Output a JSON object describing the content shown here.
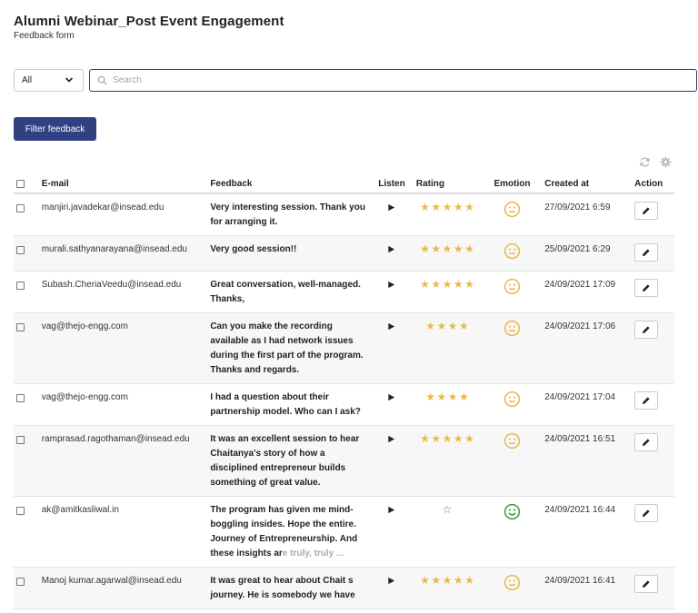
{
  "page": {
    "title": "Alumni Webinar_Post Event Engagement",
    "subtitle": "Feedback form"
  },
  "filter": {
    "selected": "All",
    "search_placeholder": "Search",
    "button_label": "Filter feedback"
  },
  "table": {
    "headers": {
      "email": "E-mail",
      "feedback": "Feedback",
      "listen": "Listen",
      "rating": "Rating",
      "emotion": "Emotion",
      "created": "Created at",
      "action": "Action"
    },
    "rows": [
      {
        "email": "manjiri.javadekar@insead.edu",
        "feedback": "Very interesting session. Thank you for arranging it.",
        "feedback_fade": "",
        "rating": 5,
        "emotion": "neutral-face-icon",
        "created": "27/09/2021 6:59"
      },
      {
        "email": "murali.sathyanarayana@insead.edu",
        "feedback": "Very good session!!",
        "feedback_fade": "",
        "rating": 5,
        "emotion": "neutral-face-icon",
        "created": "25/09/2021 6:29"
      },
      {
        "email": "Subash.CheriaVeedu@insead.edu",
        "feedback": "Great conversation, well-managed. Thanks,",
        "feedback_fade": "",
        "rating": 5,
        "emotion": "neutral-face-icon",
        "created": "24/09/2021 17:09"
      },
      {
        "email": "vag@thejo-engg.com",
        "feedback": "Can you make the recording available as I had network issues during the first part of the program. Thanks and regards.",
        "feedback_fade": "",
        "rating": 4,
        "emotion": "neutral-face-icon",
        "created": "24/09/2021 17:06"
      },
      {
        "email": "vag@thejo-engg.com",
        "feedback": "I had a question about their partnership model. Who can I ask?",
        "feedback_fade": "",
        "rating": 4,
        "emotion": "neutral-face-icon",
        "created": "24/09/2021 17:04"
      },
      {
        "email": "ramprasad.ragothaman@insead.edu",
        "feedback": "It was an excellent session to hear Chaitanya's story of how a disciplined entrepreneur builds something of great value.",
        "feedback_fade": "",
        "rating": 5,
        "emotion": "neutral-face-icon",
        "created": "24/09/2021 16:51"
      },
      {
        "email": "ak@amitkasliwal.in",
        "feedback": "The program has given me mind-boggling insides. Hope the entire. Journey of Entrepreneurship. And these insights ar",
        "feedback_fade": "e truly, truly ...",
        "rating": 0,
        "emotion": "happy-face-icon",
        "created": "24/09/2021 16:44"
      },
      {
        "email": "Manoj kumar.agarwal@insead.edu",
        "feedback": "It was great to hear about Chait s journey. He is somebody we have",
        "feedback_fade": "",
        "rating": 5,
        "emotion": "neutral-face-icon",
        "created": "24/09/2021 16:41"
      }
    ]
  },
  "colors": {
    "primary": "#2f4182",
    "star": "#e8b94a",
    "neutral_face": "#e8b94a",
    "happy_face": "#3a9a4a"
  }
}
